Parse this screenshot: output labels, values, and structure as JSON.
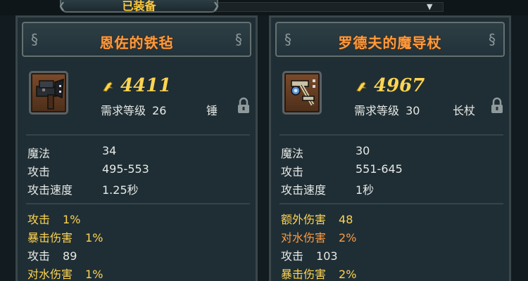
{
  "top_tab": {
    "label": "已装备",
    "arrow": "▼"
  },
  "cards": [
    {
      "name": "恩佐的铁毡",
      "icon": "hammer-icon",
      "price": "4411",
      "req_label": "需求等级",
      "req_level": "26",
      "type": "锤",
      "stats": [
        {
          "label": "魔法",
          "value": "34"
        },
        {
          "label": "攻击",
          "value": "495-553"
        },
        {
          "label": "攻击速度",
          "value": "1.25秒"
        }
      ],
      "bonuses": [
        {
          "label": "攻击",
          "value": "1%",
          "color": "#ffd451"
        },
        {
          "label": "暴击伤害",
          "value": "1%",
          "color": "#ffd451"
        },
        {
          "label": "攻击",
          "value": "89",
          "color": "#e6e8e6"
        },
        {
          "label": "对水伤害",
          "value": "1%",
          "color": "#ffd451"
        }
      ]
    },
    {
      "name": "罗德夫的魔导杖",
      "icon": "staff-icon",
      "price": "4967",
      "req_label": "需求等级",
      "req_level": "30",
      "type": "长杖",
      "stats": [
        {
          "label": "魔法",
          "value": "30"
        },
        {
          "label": "攻击",
          "value": "551-645"
        },
        {
          "label": "攻击速度",
          "value": "1秒"
        }
      ],
      "bonuses": [
        {
          "label": "额外伤害",
          "value": "48",
          "color": "#ffd451"
        },
        {
          "label": "对水伤害",
          "value": "2%",
          "color": "#ff9a3e"
        },
        {
          "label": "攻击",
          "value": "103",
          "color": "#e6e8e6"
        },
        {
          "label": "暴击伤害",
          "value": "2%",
          "color": "#ffd451"
        }
      ]
    }
  ],
  "colors": {
    "name": "#ff9a3e",
    "price": "#ffd451",
    "panel": "#1f2e34"
  }
}
